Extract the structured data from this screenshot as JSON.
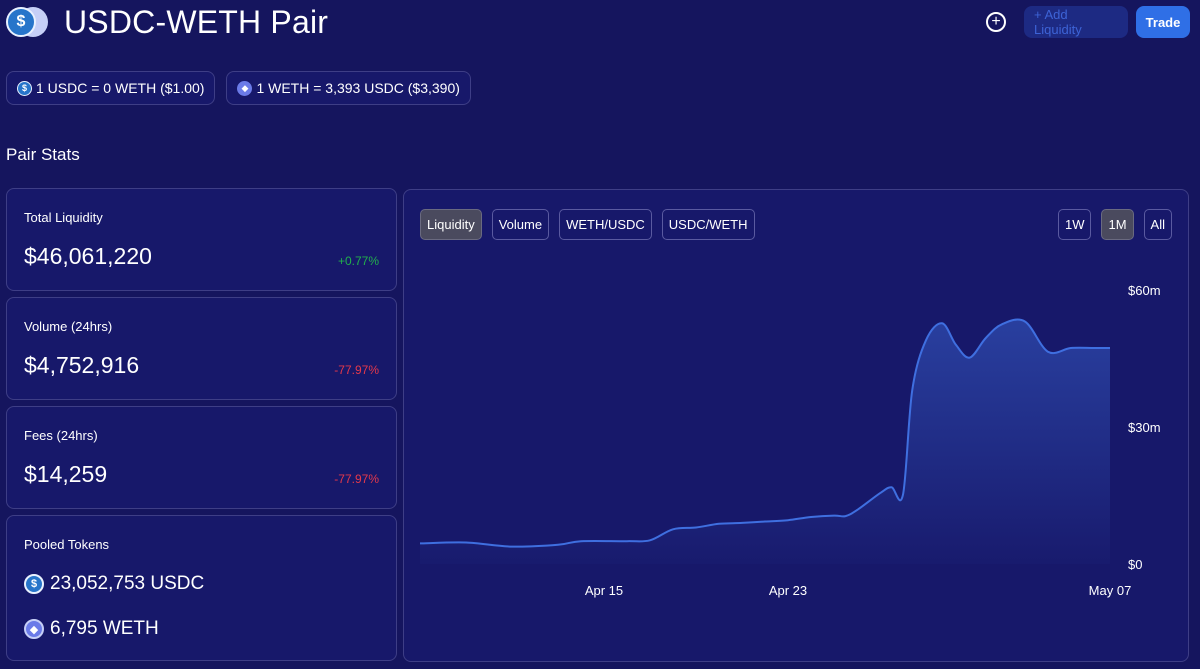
{
  "header": {
    "title": "USDC-WETH Pair",
    "add_liquidity_label": "+ Add Liquidity",
    "trade_label": "Trade",
    "plus_icon": "+"
  },
  "rates": [
    {
      "icon": "usdc-icon",
      "text": "1 USDC = 0 WETH ($1.00)"
    },
    {
      "icon": "weth-icon",
      "text": "1 WETH = 3,393 USDC ($3,390)"
    }
  ],
  "section_title": "Pair Stats",
  "stats": {
    "liquidity": {
      "label": "Total Liquidity",
      "value": "$46,061,220",
      "change": "+0.77%"
    },
    "volume": {
      "label": "Volume (24hrs)",
      "value": "$4,752,916",
      "change": "-77.97%"
    },
    "fees": {
      "label": "Fees (24hrs)",
      "value": "$14,259",
      "change": "-77.97%"
    }
  },
  "pooled": {
    "label": "Pooled Tokens",
    "usdc": "23,052,753 USDC",
    "weth": "6,795 WETH"
  },
  "chart_tabs": [
    "Liquidity",
    "Volume",
    "WETH/USDC",
    "USDC/WETH"
  ],
  "range_tabs": [
    "1W",
    "1M",
    "All"
  ],
  "colors": {
    "background": "#15155e",
    "card": "#17186a",
    "line": "#3f6fe0",
    "positive": "#22b14c",
    "negative": "#e5394a",
    "trade_button": "#2f6fe6"
  },
  "chart_data": {
    "type": "area",
    "title": "",
    "ylabel": "",
    "xlabel": "",
    "ylim": [
      0,
      60
    ],
    "y_ticks": [
      "$0",
      "$30m",
      "$60m"
    ],
    "y_tick_values": [
      0,
      30,
      60
    ],
    "x_ticks": [
      "Apr 15",
      "Apr 23",
      "May 07"
    ],
    "x_tick_values": [
      8,
      16,
      30
    ],
    "series": [
      {
        "values": [
          [
            0,
            4.5
          ],
          [
            2,
            4.7
          ],
          [
            4,
            3.8
          ],
          [
            6,
            4.2
          ],
          [
            7,
            5.0
          ],
          [
            9,
            5.0
          ],
          [
            10,
            5.2
          ],
          [
            11,
            7.6
          ],
          [
            12,
            8.0
          ],
          [
            13,
            8.8
          ],
          [
            14,
            9.0
          ],
          [
            15,
            9.3
          ],
          [
            16,
            9.6
          ],
          [
            17,
            10.3
          ],
          [
            18,
            10.6
          ],
          [
            18.5,
            10.5
          ],
          [
            19,
            11.8
          ],
          [
            20,
            15.5
          ],
          [
            20.5,
            16.8
          ],
          [
            21,
            15.2
          ],
          [
            21.4,
            38.0
          ],
          [
            22,
            49.0
          ],
          [
            22.7,
            52.7
          ],
          [
            23.3,
            48.0
          ],
          [
            23.9,
            45.2
          ],
          [
            24.6,
            49.5
          ],
          [
            25.3,
            52.5
          ],
          [
            26.3,
            53.1
          ],
          [
            27.3,
            46.5
          ],
          [
            28.3,
            47.3
          ],
          [
            29.3,
            47.3
          ],
          [
            30,
            47.3
          ]
        ]
      }
    ]
  }
}
